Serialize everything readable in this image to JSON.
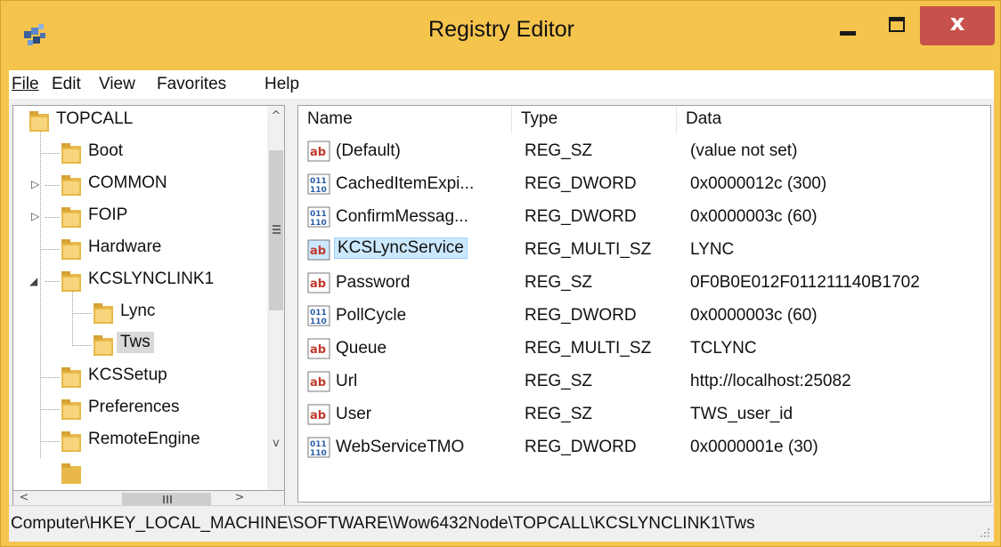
{
  "window": {
    "title": "Registry Editor",
    "close_label": "x"
  },
  "menu": [
    {
      "key": "file",
      "label": "File"
    },
    {
      "key": "edit",
      "label": "Edit"
    },
    {
      "key": "view",
      "label": "View"
    },
    {
      "key": "favorites",
      "label": "Favorites"
    },
    {
      "key": "help",
      "label": "Help"
    }
  ],
  "tree": {
    "items": [
      {
        "label": "TOPCALL",
        "expander": ""
      },
      {
        "label": "Boot",
        "expander": ""
      },
      {
        "label": "COMMON",
        "expander": "▷"
      },
      {
        "label": "FOIP",
        "expander": "▷"
      },
      {
        "label": "Hardware",
        "expander": ""
      },
      {
        "label": "KCSLYNCLINK1",
        "expander": "◢"
      },
      {
        "label": "Lync",
        "expander": ""
      },
      {
        "label": "Tws",
        "expander": "",
        "selected": true
      },
      {
        "label": "KCSSetup",
        "expander": ""
      },
      {
        "label": "Preferences",
        "expander": ""
      },
      {
        "label": "RemoteEngine",
        "expander": ""
      }
    ],
    "scroll_up": "^",
    "scroll_down": "v",
    "scroll_left": "<",
    "scroll_right": ">"
  },
  "list": {
    "columns": {
      "name": "Name",
      "type": "Type",
      "data": "Data"
    },
    "rows": [
      {
        "name": "(Default)",
        "type": "REG_SZ",
        "data": "(value not set)",
        "icon": "string-value-icon"
      },
      {
        "name": "CachedItemExpi...",
        "type": "REG_DWORD",
        "data": "0x0000012c (300)",
        "icon": "binary-value-icon"
      },
      {
        "name": "ConfirmMessag...",
        "type": "REG_DWORD",
        "data": "0x0000003c (60)",
        "icon": "binary-value-icon"
      },
      {
        "name": "KCSLyncService",
        "type": "REG_MULTI_SZ",
        "data": "LYNC",
        "icon": "string-value-icon",
        "selected": true
      },
      {
        "name": "Password",
        "type": "REG_SZ",
        "data": "0F0B0E012F011211140B1702",
        "icon": "string-value-icon"
      },
      {
        "name": "PollCycle",
        "type": "REG_DWORD",
        "data": "0x0000003c (60)",
        "icon": "binary-value-icon"
      },
      {
        "name": "Queue",
        "type": "REG_MULTI_SZ",
        "data": "TCLYNC",
        "icon": "string-value-icon"
      },
      {
        "name": "Url",
        "type": "REG_SZ",
        "data": "http://localhost:25082",
        "icon": "string-value-icon"
      },
      {
        "name": "User",
        "type": "REG_SZ",
        "data": "TWS_user_id",
        "icon": "string-value-icon"
      },
      {
        "name": "WebServiceTMO",
        "type": "REG_DWORD",
        "data": "0x0000001e (30)",
        "icon": "binary-value-icon"
      }
    ]
  },
  "status": {
    "path": "Computer\\HKEY_LOCAL_MACHINE\\SOFTWARE\\Wow6432Node\\TOPCALL\\KCSLYNCLINK1\\Tws"
  },
  "colors": {
    "frame": "#f5c44c",
    "close_button": "#c7514b",
    "selection": "#cce8ff",
    "folder": "#e8b84a"
  }
}
